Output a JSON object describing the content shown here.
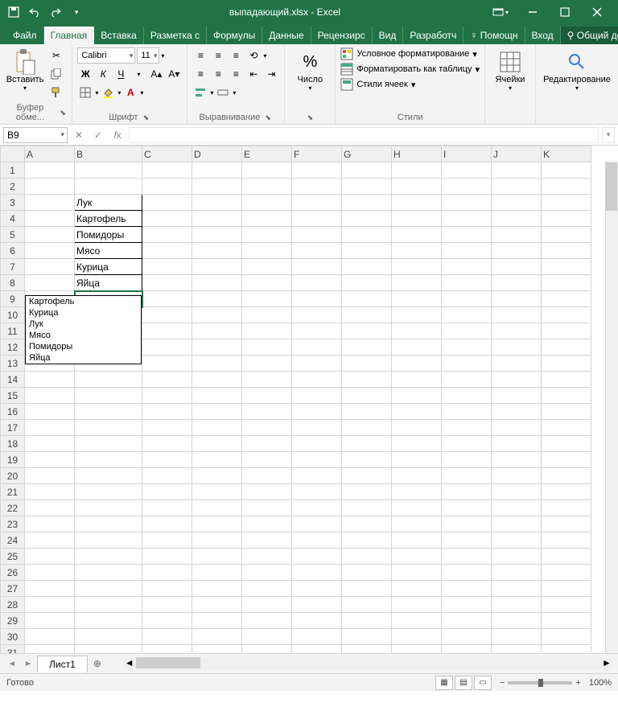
{
  "title": "выпадающий.xlsx - Excel",
  "tabs": {
    "file": "Файл",
    "home": "Главная",
    "insert": "Вставка",
    "layout": "Разметка с",
    "formulas": "Формулы",
    "data": "Данные",
    "review": "Рецензирс",
    "view": "Вид",
    "developer": "Разработч",
    "help": "Помощн",
    "signin": "Вход",
    "share": "Общий доступ"
  },
  "ribbon": {
    "clipboard_label": "Буфер обме...",
    "paste": "Вставить",
    "font_label": "Шрифт",
    "font_name": "Calibri",
    "font_size": "11",
    "align_label": "Выравнивание",
    "number_label": "Число",
    "styles_label": "Стили",
    "cond_fmt": "Условное форматирование",
    "as_table": "Форматировать как таблицу",
    "cell_styles": "Стили ячеек",
    "cells_label": "Ячейки",
    "editing_label": "Редактирование"
  },
  "namebox": "B9",
  "columns": [
    "A",
    "B",
    "C",
    "D",
    "E",
    "F",
    "G",
    "H",
    "I",
    "J",
    "K"
  ],
  "rows": 31,
  "cells_b": {
    "3": "Лук",
    "4": "Картофель",
    "5": "Помидоры",
    "6": "Мясо",
    "7": "Курица",
    "8": "Яйца"
  },
  "dropdown": [
    "Картофель",
    "Курица",
    "Лук",
    "Мясо",
    "Помидоры",
    "Яйца"
  ],
  "sheet": "Лист1",
  "status": "Готово",
  "zoom": "100%"
}
